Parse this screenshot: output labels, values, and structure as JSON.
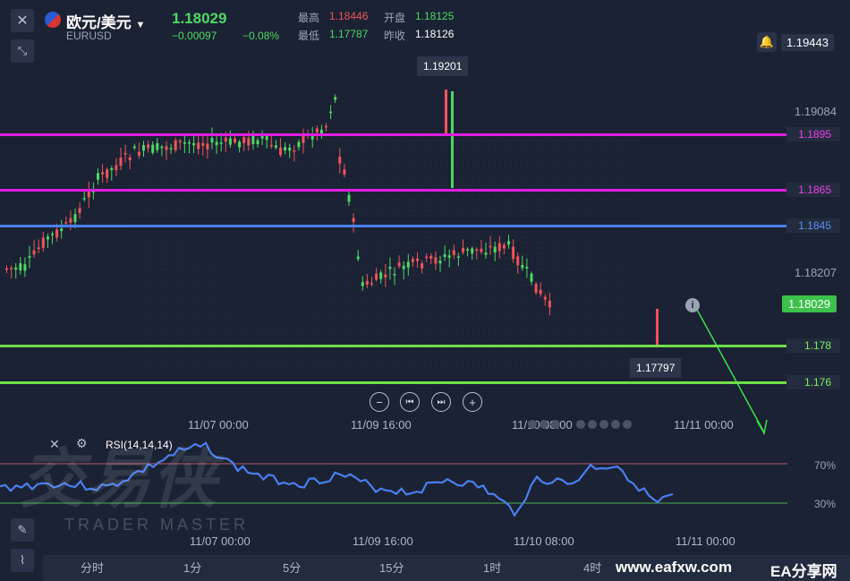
{
  "header": {
    "symbol_name": "欧元/美元",
    "symbol_code": "EURUSD",
    "price": "1.18029",
    "change": "−0.00097",
    "change_pct": "−0.08%",
    "high_label": "最高",
    "high_value": "1.18446",
    "open_label": "开盘",
    "open_value": "1.18125",
    "low_label": "最低",
    "low_value": "1.17787",
    "prev_close_label": "昨收",
    "prev_close_value": "1.18126"
  },
  "price_axis": {
    "top_value": "1.19443",
    "ticks": [
      "1.19084",
      "1.18207"
    ],
    "current_price": "1.18029"
  },
  "levels": [
    {
      "value": "1.1895",
      "color": "#e21ee3"
    },
    {
      "value": "1.1865",
      "color": "#e21ee3"
    },
    {
      "value": "1.1845",
      "color": "#4a7ff0"
    },
    {
      "value": "1.178",
      "color": "#6fe04a"
    },
    {
      "value": "1.176",
      "color": "#6fe04a"
    }
  ],
  "callouts": {
    "high": "1.19201",
    "low": "1.17797"
  },
  "time_axis": {
    "labels": [
      "11/07 00:00",
      "11/09 16:00",
      "11/10 08:00",
      "11/11 00:00"
    ]
  },
  "rsi": {
    "title": "RSI(14,14,14)",
    "upper": "70%",
    "lower": "30%"
  },
  "watermark": {
    "cn": "交易侠",
    "en": "TRADER MASTER"
  },
  "timeframes": [
    "分时",
    "1分",
    "5分",
    "15分",
    "1时",
    "4时"
  ],
  "footer": {
    "site": "www.eafxw.com",
    "brand": "EA分享网"
  },
  "colors": {
    "up": "#4cd964",
    "down": "#f0545a",
    "bg": "#1b2233",
    "rsi_line": "#4a7ff0"
  }
}
